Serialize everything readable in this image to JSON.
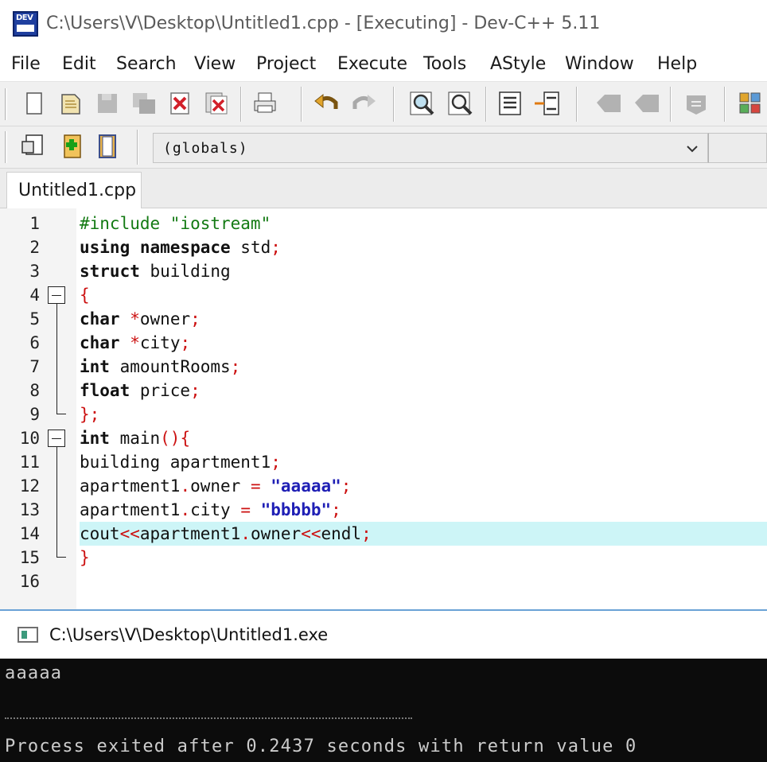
{
  "window": {
    "title": "C:\\Users\\V\\Desktop\\Untitled1.cpp - [Executing] - Dev-C++ 5.11",
    "icon_label": "DEV"
  },
  "menu": [
    "File",
    "Edit",
    "Search",
    "View",
    "Project",
    "Execute",
    "Tools",
    "AStyle",
    "Window",
    "Help"
  ],
  "toolbar": {
    "icons": [
      "new-file-icon",
      "open-file-icon",
      "save-icon",
      "save-all-icon",
      "close-icon",
      "close-all-icon",
      "print-icon",
      "undo-icon",
      "redo-icon",
      "find-icon",
      "replace-icon",
      "indent-icon",
      "unindent-icon",
      "bookmark-icon",
      "goto-bookmark-icon",
      "compile-options-icon",
      "grid-icon"
    ],
    "class_icons": [
      "class-browser-icon",
      "add-file-icon",
      "project-icon"
    ],
    "scope_select": "(globals)"
  },
  "tabs": [
    {
      "label": "Untitled1.cpp",
      "active": true
    }
  ],
  "editor": {
    "active_line": 14,
    "lines": [
      {
        "n": "1",
        "tokens": [
          {
            "t": "#include \"iostream\"",
            "c": "pre"
          }
        ]
      },
      {
        "n": "2",
        "tokens": [
          {
            "t": "using namespace",
            "c": "kw"
          },
          {
            "t": " std",
            "c": "plain"
          },
          {
            "t": ";",
            "c": "op"
          }
        ]
      },
      {
        "n": "3",
        "tokens": [
          {
            "t": "struct",
            "c": "kw"
          },
          {
            "t": " building",
            "c": "plain"
          }
        ]
      },
      {
        "n": "4",
        "tokens": [
          {
            "t": "{",
            "c": "op"
          }
        ]
      },
      {
        "n": "5",
        "tokens": [
          {
            "t": "char",
            "c": "kw"
          },
          {
            "t": " ",
            "c": "plain"
          },
          {
            "t": "*",
            "c": "op"
          },
          {
            "t": "owner",
            "c": "plain"
          },
          {
            "t": ";",
            "c": "op"
          }
        ]
      },
      {
        "n": "6",
        "tokens": [
          {
            "t": "char",
            "c": "kw"
          },
          {
            "t": " ",
            "c": "plain"
          },
          {
            "t": "*",
            "c": "op"
          },
          {
            "t": "city",
            "c": "plain"
          },
          {
            "t": ";",
            "c": "op"
          }
        ]
      },
      {
        "n": "7",
        "tokens": [
          {
            "t": "int",
            "c": "kw"
          },
          {
            "t": " amountRooms",
            "c": "plain"
          },
          {
            "t": ";",
            "c": "op"
          }
        ]
      },
      {
        "n": "8",
        "tokens": [
          {
            "t": "float",
            "c": "kw"
          },
          {
            "t": " price",
            "c": "plain"
          },
          {
            "t": ";",
            "c": "op"
          }
        ]
      },
      {
        "n": "9",
        "tokens": [
          {
            "t": "};",
            "c": "op"
          }
        ]
      },
      {
        "n": "10",
        "tokens": [
          {
            "t": "int",
            "c": "kw"
          },
          {
            "t": " main",
            "c": "plain"
          },
          {
            "t": "(){",
            "c": "op"
          }
        ]
      },
      {
        "n": "11",
        "tokens": [
          {
            "t": "building apartment1",
            "c": "plain"
          },
          {
            "t": ";",
            "c": "op"
          }
        ]
      },
      {
        "n": "12",
        "tokens": [
          {
            "t": "apartment1",
            "c": "plain"
          },
          {
            "t": ".",
            "c": "op"
          },
          {
            "t": "owner ",
            "c": "plain"
          },
          {
            "t": "=",
            "c": "op"
          },
          {
            "t": " ",
            "c": "plain"
          },
          {
            "t": "\"aaaaa\"",
            "c": "str"
          },
          {
            "t": ";",
            "c": "op"
          }
        ]
      },
      {
        "n": "13",
        "tokens": [
          {
            "t": "apartment1",
            "c": "plain"
          },
          {
            "t": ".",
            "c": "op"
          },
          {
            "t": "city ",
            "c": "plain"
          },
          {
            "t": "=",
            "c": "op"
          },
          {
            "t": " ",
            "c": "plain"
          },
          {
            "t": "\"bbbbb\"",
            "c": "str"
          },
          {
            "t": ";",
            "c": "op"
          }
        ]
      },
      {
        "n": "14",
        "tokens": [
          {
            "t": "cout",
            "c": "plain"
          },
          {
            "t": "<<",
            "c": "op"
          },
          {
            "t": "apartment1",
            "c": "plain"
          },
          {
            "t": ".",
            "c": "op"
          },
          {
            "t": "owner",
            "c": "plain"
          },
          {
            "t": "<<",
            "c": "op"
          },
          {
            "t": "endl",
            "c": "plain"
          },
          {
            "t": ";",
            "c": "op"
          }
        ]
      },
      {
        "n": "15",
        "tokens": [
          {
            "t": "}",
            "c": "op"
          }
        ]
      },
      {
        "n": "16",
        "tokens": []
      }
    ]
  },
  "console": {
    "title": "C:\\Users\\V\\Desktop\\Untitled1.exe",
    "output": "aaaaa",
    "process_message": "Process exited after 0.2437 seconds with return value 0"
  },
  "colors": {
    "preprocessor": "#137a13",
    "operator": "#cc1111",
    "string": "#1f1fb5",
    "active_line": "#cdf5f7",
    "console_bg": "#0c0c0c"
  }
}
